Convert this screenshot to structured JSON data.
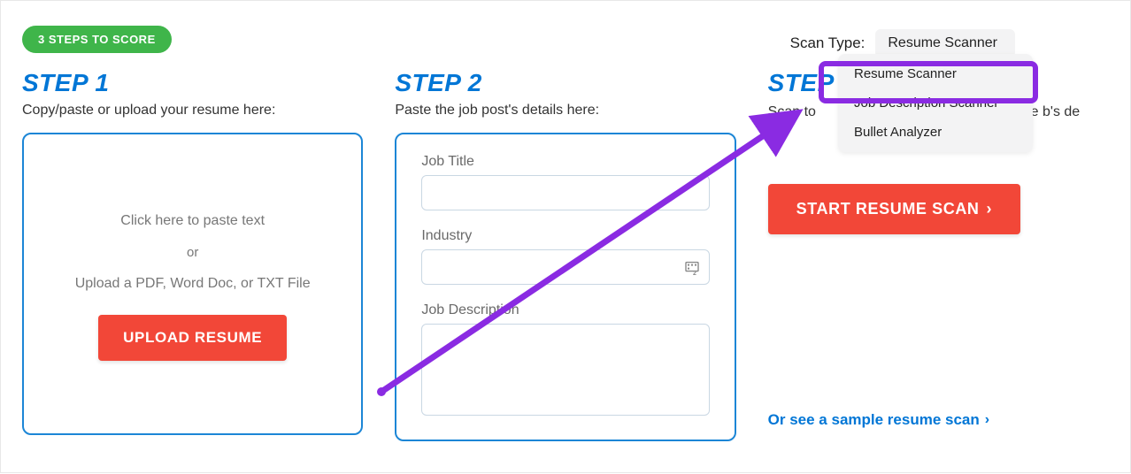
{
  "badge": "3 STEPS TO SCORE",
  "step1": {
    "heading": "STEP 1",
    "desc": "Copy/paste or upload your resume here:",
    "paste_text": "Click here to paste text",
    "or_text": "or",
    "upload_hint": "Upload a PDF, Word Doc, or TXT File",
    "upload_button": "UPLOAD RESUME"
  },
  "step2": {
    "heading": "STEP 2",
    "desc": "Paste the job post's details here:",
    "job_title_label": "Job Title",
    "industry_label": "Industry",
    "job_desc_label": "Job Description"
  },
  "step3": {
    "heading": "STEP 3",
    "desc_pre": "Scan to",
    "desc_post": "ume vs the b's de",
    "start_button": "START RESUME SCAN",
    "sample_link": "Or see a sample resume scan"
  },
  "scan_type": {
    "label": "Scan Type:",
    "selected": "Resume Scanner",
    "options": [
      "Resume Scanner",
      "Job Description Scanner",
      "Bullet Analyzer"
    ]
  },
  "icons": {
    "chevron_right": "›"
  }
}
